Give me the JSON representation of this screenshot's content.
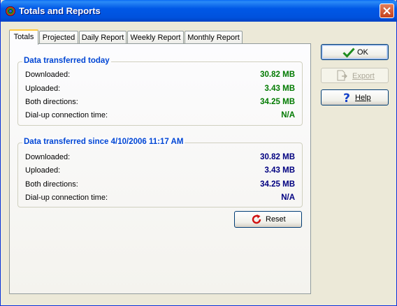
{
  "window": {
    "title": "Totals and Reports"
  },
  "tabs": [
    {
      "label": "Totals"
    },
    {
      "label": "Projected"
    },
    {
      "label": "Daily Report"
    },
    {
      "label": "Weekly Report"
    },
    {
      "label": "Monthly Report"
    }
  ],
  "today": {
    "title": "Data transferred today",
    "rows": [
      {
        "label": "Downloaded:",
        "value": "30.82 MB"
      },
      {
        "label": "Uploaded:",
        "value": "3.43 MB"
      },
      {
        "label": "Both directions:",
        "value": "34.25 MB"
      },
      {
        "label": "Dial-up connection time:",
        "value": "N/A"
      }
    ]
  },
  "since": {
    "title": "Data transferred since 4/10/2006 11:17 AM",
    "rows": [
      {
        "label": "Downloaded:",
        "value": "30.82 MB"
      },
      {
        "label": "Uploaded:",
        "value": "3.43 MB"
      },
      {
        "label": "Both directions:",
        "value": "34.25 MB"
      },
      {
        "label": "Dial-up connection time:",
        "value": "N/A"
      }
    ]
  },
  "buttons": {
    "reset_label": "Reset",
    "ok_label": "OK",
    "export_label": "Export",
    "help_label": "Help"
  },
  "colors": {
    "today_values": "#007A00",
    "since_values": "#000080",
    "group_title": "#0046D5"
  }
}
